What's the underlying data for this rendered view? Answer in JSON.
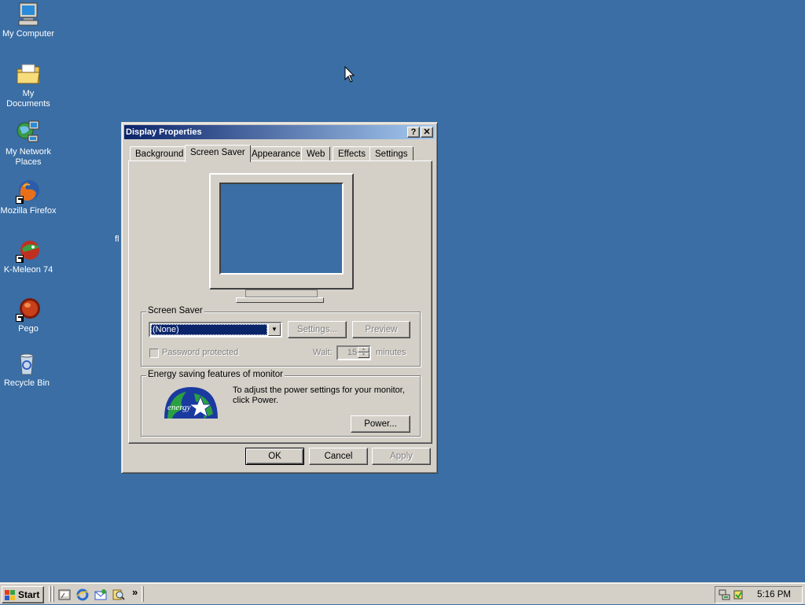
{
  "desktop": {
    "icons": [
      {
        "label": "My Computer",
        "icon": "my-computer-icon"
      },
      {
        "label": "My Documents",
        "icon": "my-documents-icon"
      },
      {
        "label": "My Network",
        "label2": "Places",
        "icon": "my-network-places-icon"
      },
      {
        "label": "Mozilla Firefox",
        "icon": "firefox-icon"
      },
      {
        "label": "K-Meleon 74",
        "icon": "k-meleon-icon"
      },
      {
        "label": "Pego",
        "icon": "pego-icon"
      },
      {
        "label": "Recycle Bin",
        "icon": "recycle-bin-icon"
      }
    ],
    "stray_text": "fl",
    "background_color": "#3a6ea5"
  },
  "window": {
    "title": "Display Properties",
    "help_glyph": "?",
    "close_glyph": "✕",
    "tabs": [
      {
        "label": "Background"
      },
      {
        "label": "Screen Saver",
        "active": true
      },
      {
        "label": "Appearance"
      },
      {
        "label": "Web"
      },
      {
        "label": "Effects"
      },
      {
        "label": "Settings"
      }
    ],
    "screen_saver": {
      "group_label": "Screen Saver",
      "selected": "(None)",
      "settings_label": "Settings...",
      "preview_label": "Preview",
      "password_label": "Password protected",
      "wait_label": "Wait:",
      "wait_value": "15",
      "minutes_label": "minutes"
    },
    "energy": {
      "group_label": "Energy saving features of monitor",
      "description": "To adjust the power settings for your monitor, click Power.",
      "power_label": "Power...",
      "logo_text": "energy"
    },
    "buttons": {
      "ok": "OK",
      "cancel": "Cancel",
      "apply": "Apply"
    }
  },
  "taskbar": {
    "start_label": "Start",
    "chevron": "»",
    "clock": "5:16 PM"
  },
  "colors": {
    "title_active": "#0a246a",
    "face": "#d4d0c8",
    "selection": "#0a246a"
  }
}
